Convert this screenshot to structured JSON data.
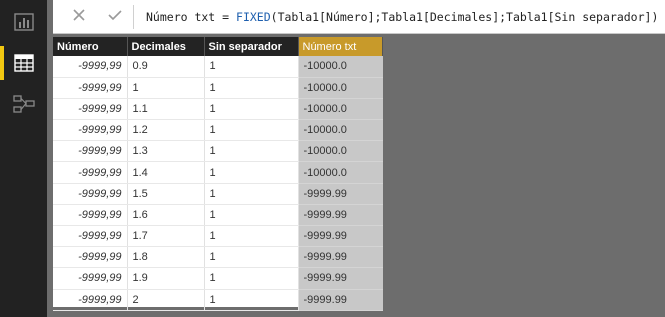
{
  "sidebar": {
    "items": [
      {
        "name": "report-view",
        "icon": "bar-chart-icon",
        "active": false
      },
      {
        "name": "data-view",
        "icon": "table-grid-icon",
        "active": true
      },
      {
        "name": "relationships-view",
        "icon": "relationships-icon",
        "active": false
      }
    ],
    "accent": "#f2c811"
  },
  "formula_bar": {
    "cancel_icon": "close-icon",
    "commit_icon": "check-icon",
    "prefix": "Número txt = ",
    "function": "FIXED",
    "args": "(Tabla1[Número];Tabla1[Decimales];Tabla1[Sin separador])"
  },
  "table": {
    "columns": [
      "Número",
      "Decimales",
      "Sin separador",
      "Número txt"
    ],
    "selected_column": "Número txt",
    "selected_color": "#c89a2a",
    "rows": [
      [
        "-9999,99",
        "0.9",
        "1",
        "-10000.0"
      ],
      [
        "-9999,99",
        "1",
        "1",
        "-10000.0"
      ],
      [
        "-9999,99",
        "1.1",
        "1",
        "-10000.0"
      ],
      [
        "-9999,99",
        "1.2",
        "1",
        "-10000.0"
      ],
      [
        "-9999,99",
        "1.3",
        "1",
        "-10000.0"
      ],
      [
        "-9999,99",
        "1.4",
        "1",
        "-10000.0"
      ],
      [
        "-9999,99",
        "1.5",
        "1",
        "-9999.99"
      ],
      [
        "-9999,99",
        "1.6",
        "1",
        "-9999.99"
      ],
      [
        "-9999,99",
        "1.7",
        "1",
        "-9999.99"
      ],
      [
        "-9999,99",
        "1.8",
        "1",
        "-9999.99"
      ],
      [
        "-9999,99",
        "1.9",
        "1",
        "-9999.99"
      ],
      [
        "-9999,99",
        "2",
        "1",
        "-9999.99"
      ]
    ]
  }
}
